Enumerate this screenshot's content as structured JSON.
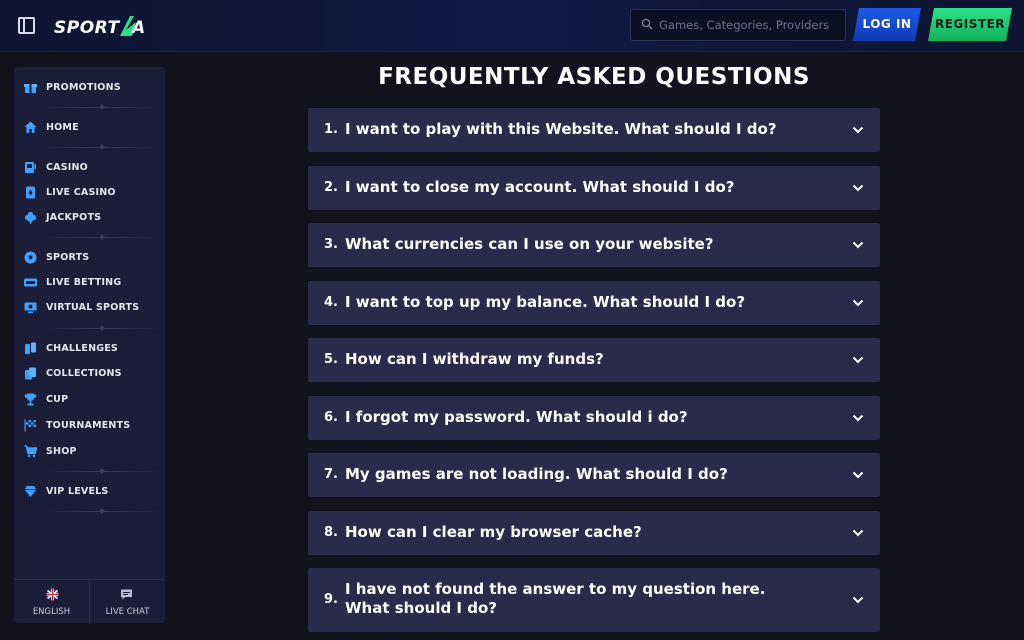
{
  "header": {
    "logo_text": "SPORTASA",
    "search_placeholder": "Games, Categories, Providers",
    "login_label": "LOG IN",
    "register_label": "REGISTER"
  },
  "sidebar": {
    "items": [
      {
        "label": "PROMOTIONS",
        "icon": "gift-icon"
      },
      {
        "label": "HOME",
        "icon": "home-icon"
      },
      {
        "label": "CASINO",
        "icon": "slot-machine-icon"
      },
      {
        "label": "LIVE CASINO",
        "icon": "live-casino-icon"
      },
      {
        "label": "JACKPOTS",
        "icon": "clover-icon"
      },
      {
        "label": "SPORTS",
        "icon": "soccer-ball-icon"
      },
      {
        "label": "LIVE BETTING",
        "icon": "live-badge-icon"
      },
      {
        "label": "VIRTUAL SPORTS",
        "icon": "virtual-sports-icon"
      },
      {
        "label": "CHALLENGES",
        "icon": "challenges-icon"
      },
      {
        "label": "COLLECTIONS",
        "icon": "cards-icon"
      },
      {
        "label": "CUP",
        "icon": "trophy-icon"
      },
      {
        "label": "TOURNAMENTS",
        "icon": "checkered-flag-icon"
      },
      {
        "label": "SHOP",
        "icon": "shop-cart-icon"
      },
      {
        "label": "VIP LEVELS",
        "icon": "diamond-icon"
      }
    ],
    "language_label": "ENGLISH",
    "chat_label": "LIVE CHAT"
  },
  "main": {
    "title": "FREQUENTLY ASKED QUESTIONS",
    "faqs": [
      {
        "num": "1.",
        "question": "I want to play with this Website. What should I do?"
      },
      {
        "num": "2.",
        "question": "I want to close my account. What should I do?"
      },
      {
        "num": "3.",
        "question": "What currencies can I use on your website?"
      },
      {
        "num": "4.",
        "question": "I want to top up my balance. What should I do?"
      },
      {
        "num": "5.",
        "question": "How can I withdraw my funds?"
      },
      {
        "num": "6.",
        "question": "I forgot my password. What should i do?"
      },
      {
        "num": "7.",
        "question": "My games are not loading. What should I do?"
      },
      {
        "num": "8.",
        "question": "How can I clear my browser cache?"
      },
      {
        "num": "9.",
        "question": "I have not found the answer to my question here. What should I do?"
      }
    ]
  },
  "colors": {
    "background": "#13131f",
    "panel": "#1c1d36",
    "faq_row": "#2a2b4a",
    "login": "#1e5be6",
    "register": "#2de08a",
    "icon_blue": "#3ea0ff"
  }
}
